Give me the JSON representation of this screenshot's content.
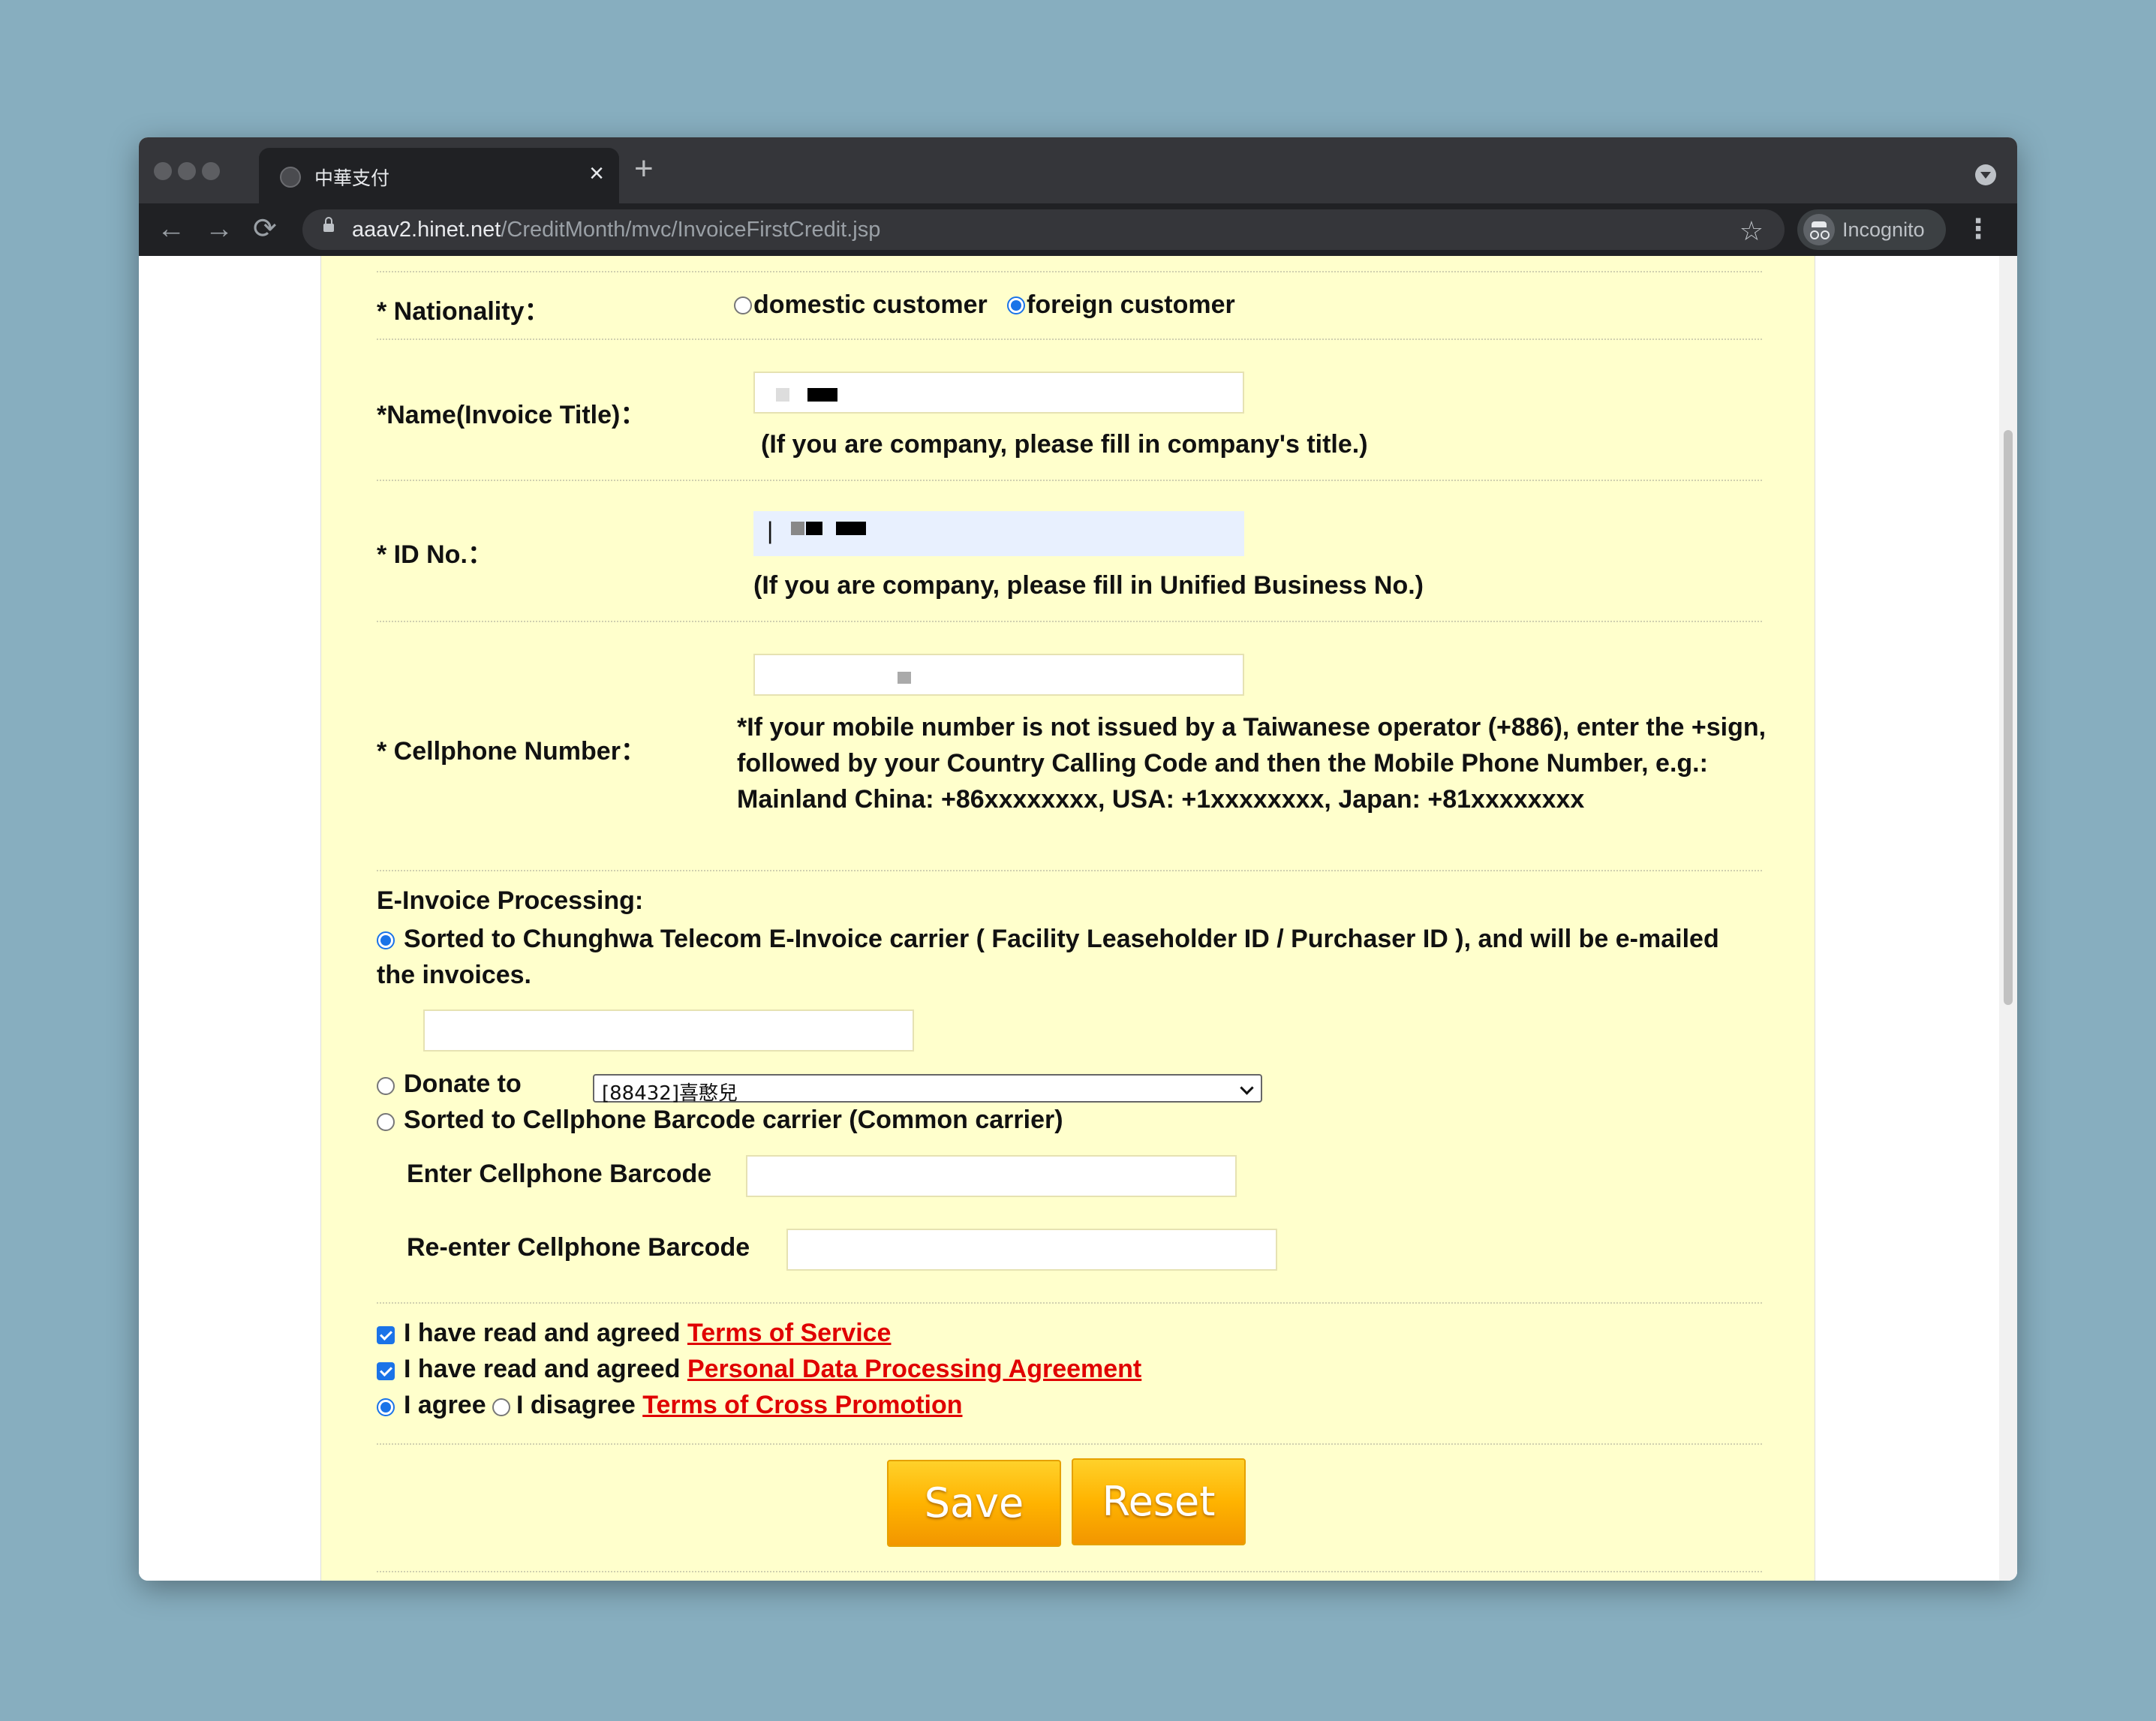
{
  "browser": {
    "tab_title": "中華支付",
    "tab_close": "×",
    "new_tab": "+",
    "back": "←",
    "forward": "→",
    "reload": "⟳",
    "url_host": "aaav2.hinet.net",
    "url_path": "/CreditMonth/mvc/InvoiceFirstCredit.jsp",
    "bookmark_star": "☆",
    "profile_label": "Incognito",
    "menu": "⋮"
  },
  "form": {
    "nationality": {
      "label": "* Nationality：",
      "options": [
        "domestic customer",
        "foreign customer"
      ],
      "selected": "foreign customer"
    },
    "name": {
      "label": "*Name(Invoice Title)：",
      "note": "(If you are company, please fill in company's title.)"
    },
    "id_no": {
      "label": "* ID No.：",
      "cursor": "|",
      "note": "(If you are company, please fill in Unified Business No.)"
    },
    "cellphone": {
      "label": "* Cellphone Number：",
      "note": "*If your mobile number is not issued by a Taiwanese operator (+886), enter the +sign, followed by your Country Calling Code and then the Mobile Phone Number, e.g.: Mainland China: +86xxxxxxxx, USA: +1xxxxxxxx, Japan: +81xxxxxxxx"
    },
    "einvoice": {
      "heading": "E-Invoice Processing:",
      "option_chunghwa": "Sorted to Chunghwa Telecom E-Invoice carrier ( Facility Leaseholder ID / Purchaser ID ), and will be e-mailed the invoices.",
      "option_donate": "Donate to",
      "donate_selected": "[88432]喜憨兒",
      "option_barcode": "Sorted to Cellphone Barcode carrier (Common carrier)",
      "barcode_label": "Enter Cellphone Barcode",
      "barcode_reenter_label": "Re-enter Cellphone Barcode",
      "selected": "chunghwa"
    },
    "agreements": {
      "prefix": "I have read and agreed",
      "terms_link": "Terms of Service",
      "privacy_link": "Personal Data Processing Agreement",
      "agree_label": "I agree",
      "disagree_label": "I disagree",
      "cross_link": "Terms of Cross Promotion",
      "terms_checked": true,
      "privacy_checked": true,
      "cross_selected": "agree"
    },
    "buttons": {
      "save": "Save",
      "reset": "Reset"
    }
  },
  "colors": {
    "panel_bg": "#ffffcc",
    "link": "#e00000",
    "button_gradient": [
      "#ffd12a",
      "#f29600"
    ],
    "radio_accent": "#1a73e8"
  }
}
